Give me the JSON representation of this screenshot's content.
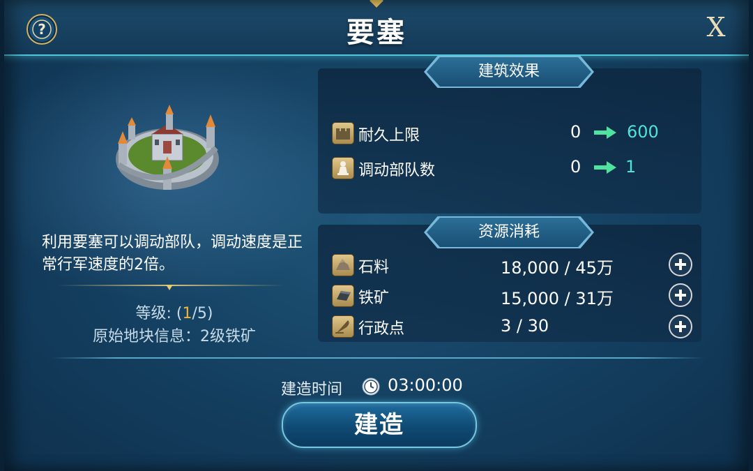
{
  "header": {
    "title": "要塞",
    "close_label": "X"
  },
  "info": {
    "description": "利用要塞可以调动部队，调动速度是正常行军速度的2倍。",
    "level_prefix": "等级: (",
    "level_current": "1",
    "level_suffix": "/5)",
    "origin_label": "原始地块信息：",
    "origin_value": "2级铁矿"
  },
  "effects": {
    "title": "建筑效果",
    "rows": [
      {
        "label": "耐久上限",
        "from": "0",
        "to": "600",
        "icon": "wall-icon"
      },
      {
        "label": "调动部队数",
        "from": "0",
        "to": "1",
        "icon": "pawn-icon"
      }
    ]
  },
  "costs": {
    "title": "资源消耗",
    "rows": [
      {
        "label": "石料",
        "amount": "18,000 / 45万",
        "icon": "stone-icon"
      },
      {
        "label": "铁矿",
        "amount": "15,000 / 31万",
        "icon": "iron-icon"
      },
      {
        "label": "行政点",
        "amount": "3 / 30",
        "icon": "quill-icon"
      }
    ]
  },
  "build": {
    "time_label": "建造时间",
    "time_value": "03:00:00",
    "button_label": "建造"
  },
  "colors": {
    "accent_cyan": "#4fe3d6",
    "gold": "#f0b43a",
    "frame_glow": "#4fc8dc"
  }
}
